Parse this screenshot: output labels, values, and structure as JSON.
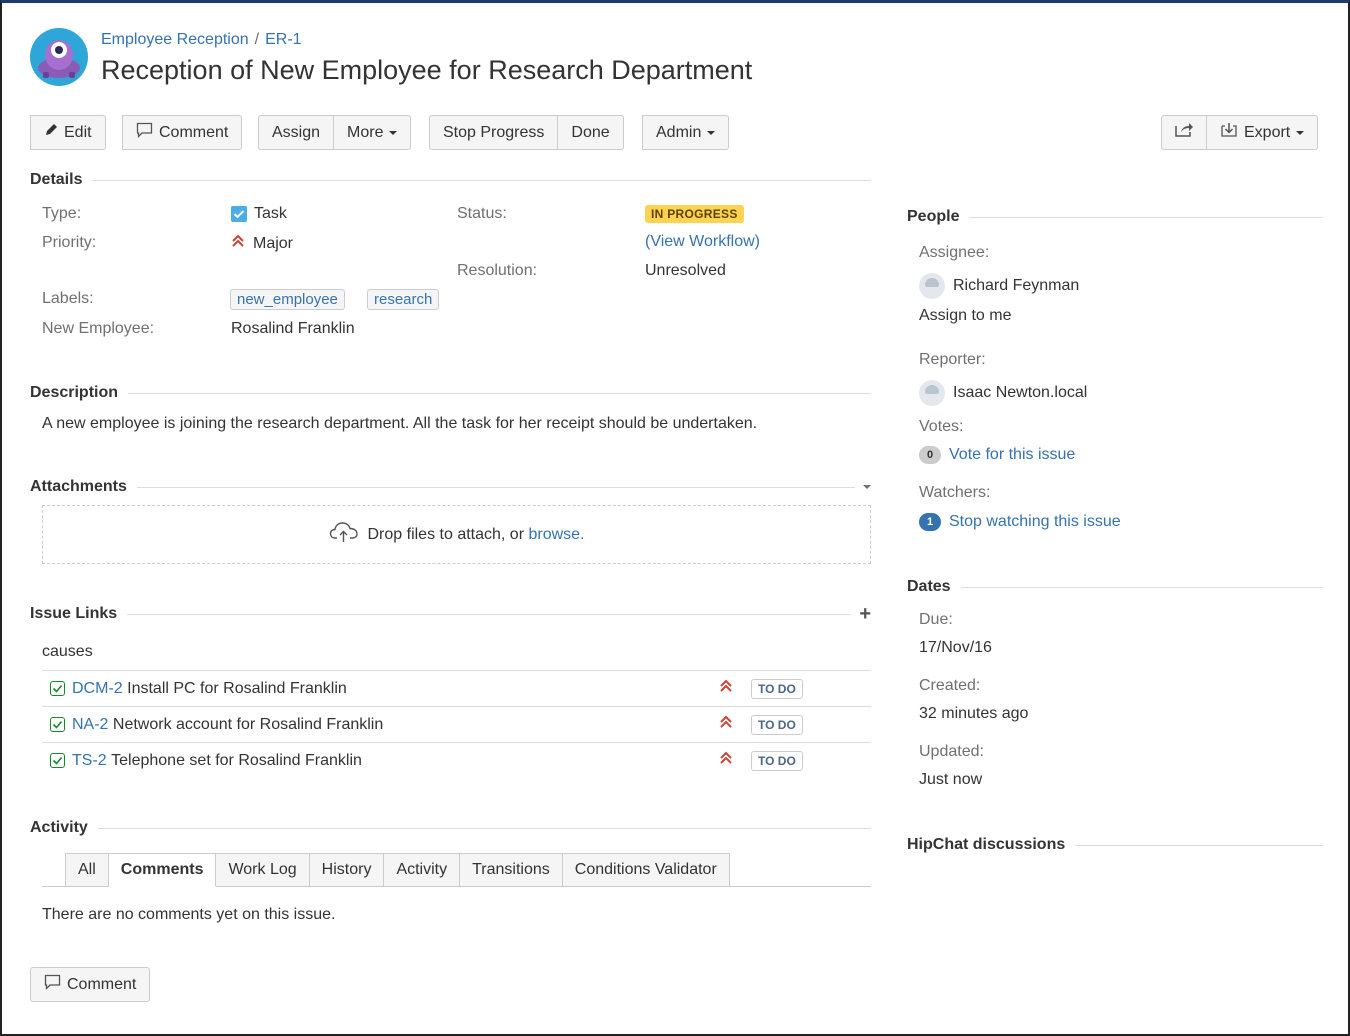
{
  "header": {
    "project": "Employee Reception",
    "separator": "/",
    "issue_key": "ER-1",
    "title": "Reception of New Employee for Research Department"
  },
  "toolbar": {
    "edit": "Edit",
    "comment": "Comment",
    "assign": "Assign",
    "more": "More",
    "stop_progress": "Stop Progress",
    "done": "Done",
    "admin": "Admin",
    "export": "Export"
  },
  "details": {
    "heading": "Details",
    "type_label": "Type:",
    "type_value": "Task",
    "priority_label": "Priority:",
    "priority_value": "Major",
    "labels_label": "Labels:",
    "labels": [
      "new_employee",
      "research"
    ],
    "new_employee_label": "New Employee:",
    "new_employee_value": "Rosalind Franklin",
    "status_label": "Status:",
    "status_value": "IN PROGRESS",
    "view_workflow_open": "(",
    "view_workflow": "View Workflow",
    "view_workflow_close": ")",
    "resolution_label": "Resolution:",
    "resolution_value": "Unresolved"
  },
  "description": {
    "heading": "Description",
    "text": "A new employee is joining the research department. All the task for her receipt should be undertaken."
  },
  "attachments": {
    "heading": "Attachments",
    "drop_text": "Drop files to attach, or",
    "browse": "browse."
  },
  "issue_links": {
    "heading": "Issue Links",
    "relation": "causes",
    "items": [
      {
        "key": "DCM-2",
        "summary": "Install PC for Rosalind Franklin",
        "status": "TO DO"
      },
      {
        "key": "NA-2",
        "summary": "Network account for Rosalind Franklin",
        "status": "TO DO"
      },
      {
        "key": "TS-2",
        "summary": "Telephone set for Rosalind Franklin",
        "status": "TO DO"
      }
    ]
  },
  "activity": {
    "heading": "Activity",
    "tabs": [
      "All",
      "Comments",
      "Work Log",
      "History",
      "Activity",
      "Transitions",
      "Conditions Validator"
    ],
    "active_tab": "Comments",
    "empty_text": "There are no comments yet on this issue.",
    "comment_button": "Comment"
  },
  "people": {
    "heading": "People",
    "assignee_label": "Assignee:",
    "assignee": "Richard Feynman",
    "assign_to_me": "Assign to me",
    "reporter_label": "Reporter:",
    "reporter": "Isaac Newton.local",
    "votes_label": "Votes:",
    "votes_count": "0",
    "vote_link": "Vote for this issue",
    "watchers_label": "Watchers:",
    "watchers_count": "1",
    "watch_link": "Stop watching this issue"
  },
  "dates": {
    "heading": "Dates",
    "due_label": "Due:",
    "due": "17/Nov/16",
    "created_label": "Created:",
    "created": "32 minutes ago",
    "updated_label": "Updated:",
    "updated": "Just now"
  },
  "hipchat": {
    "heading": "HipChat discussions"
  },
  "colors": {
    "link": "#3572b0",
    "in_progress_bg": "#ffd351",
    "priority_major": "#d04437",
    "watch_badge": "#3572b0"
  }
}
